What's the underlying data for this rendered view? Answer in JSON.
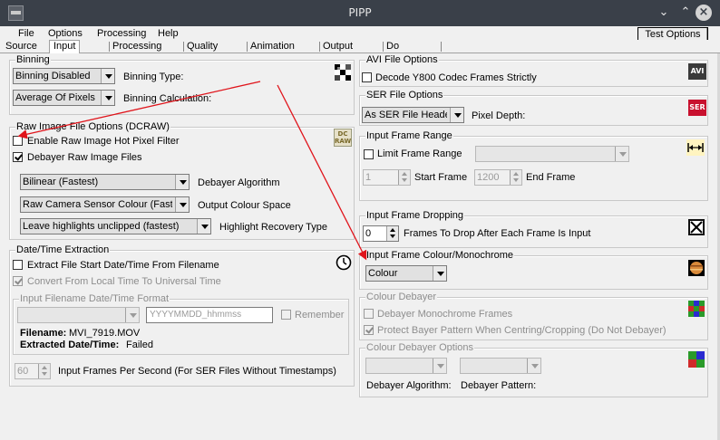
{
  "window": {
    "title": "PIPP"
  },
  "menu": {
    "items": [
      "File",
      "Options",
      "Processing",
      "Help"
    ],
    "test_options": "Test Options"
  },
  "tabs": [
    "Source",
    "Input",
    "Processing",
    "Quality",
    "Animation",
    "Output",
    "Do"
  ],
  "binning": {
    "title": "Binning",
    "type_value": "Binning Disabled",
    "type_label": "Binning Type:",
    "calc_value": "Average Of Pixels",
    "calc_label": "Binning Calculation:"
  },
  "raw": {
    "title": "Raw Image File Options (DCRAW)",
    "hot_pixel": "Enable Raw Image Hot Pixel Filter",
    "debayer": "Debayer Raw Image Files",
    "algo_value": "Bilinear (Fastest)",
    "algo_label": "Debayer Algorithm",
    "colour_value": "Raw Camera Sensor Colour (Fastest)",
    "colour_label": "Output Colour Space",
    "highlight_value": "Leave highlights unclipped (fastest)",
    "highlight_label": "Highlight Recovery Type",
    "icon_text_1": "DC",
    "icon_text_2": "RAW"
  },
  "datetime": {
    "title": "Date/Time Extraction",
    "extract": "Extract File Start Date/Time From Filename",
    "convert": "Convert From Local Time To Universal Time",
    "format_title": "Input Filename Date/Time Format",
    "format_placeholder": "YYYYMMDD_hhmmss",
    "remember": "Remember",
    "filename_label": "Filename:",
    "filename_value": "MVI_7919.MOV",
    "extracted_label": "Extracted Date/Time:",
    "extracted_value": "Failed",
    "fps_value": "60",
    "fps_label": "Input Frames Per Second (For SER Files Without Timestamps)"
  },
  "avi": {
    "title": "AVI File Options",
    "decode": "Decode Y800 Codec Frames Strictly",
    "icon_text": "AVI"
  },
  "ser": {
    "title": "SER File Options",
    "header_value": "As SER File Header",
    "depth_label": "Pixel Depth:",
    "icon_text": "SER"
  },
  "range": {
    "title": "Input Frame Range",
    "limit": "Limit Frame Range",
    "start_value": "1",
    "start_label": "Start Frame",
    "end_value": "1200",
    "end_label": "End Frame"
  },
  "dropping": {
    "title": "Input Frame Dropping",
    "value": "0",
    "label": "Frames To Drop After Each Frame Is Input"
  },
  "colour_mono": {
    "title": "Input Frame Colour/Monochrome",
    "value": "Colour"
  },
  "colour_debayer": {
    "title": "Colour Debayer",
    "mono": "Debayer Monochrome Frames",
    "protect": "Protect Bayer Pattern When Centring/Cropping (Do Not Debayer)"
  },
  "debayer_options": {
    "title": "Colour Debayer Options",
    "algo_label": "Debayer Algorithm:",
    "pattern_label": "Debayer Pattern:"
  },
  "colors": {
    "titlebar": "#3a4049",
    "panel": "#f0f0f0",
    "arrow": "#e0141b",
    "ser_icon": "#c8102e"
  }
}
